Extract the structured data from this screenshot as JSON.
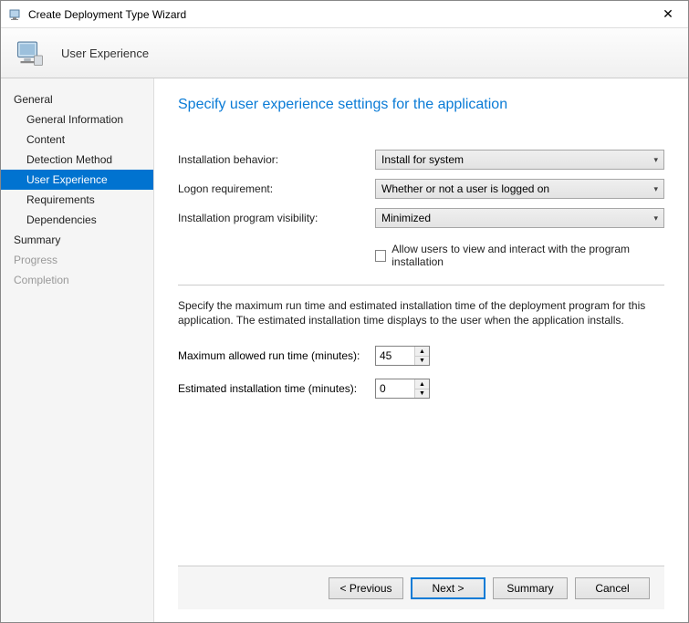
{
  "window": {
    "title": "Create Deployment Type Wizard"
  },
  "header": {
    "title": "User Experience"
  },
  "nav": {
    "items": [
      {
        "label": "General"
      },
      {
        "label": "General Information"
      },
      {
        "label": "Content"
      },
      {
        "label": "Detection Method"
      },
      {
        "label": "User Experience"
      },
      {
        "label": "Requirements"
      },
      {
        "label": "Dependencies"
      },
      {
        "label": "Summary"
      },
      {
        "label": "Progress"
      },
      {
        "label": "Completion"
      }
    ]
  },
  "content": {
    "title": "Specify user experience settings for the application",
    "labels": {
      "install_behavior": "Installation behavior:",
      "logon_req": "Logon requirement:",
      "visibility": "Installation program visibility:",
      "allow_interact": "Allow users to view and interact with the program installation",
      "instruction": "Specify the maximum run time and estimated installation time of the deployment program for this application. The estimated installation time displays to the user when the application installs.",
      "max_runtime": "Maximum allowed run time (minutes):",
      "est_time": "Estimated installation time (minutes):"
    },
    "values": {
      "install_behavior": "Install for system",
      "logon_req": "Whether or not a user is logged on",
      "visibility": "Minimized",
      "max_runtime": "45",
      "est_time": "0"
    }
  },
  "footer": {
    "previous": "< Previous",
    "next": "Next >",
    "summary": "Summary",
    "cancel": "Cancel"
  }
}
